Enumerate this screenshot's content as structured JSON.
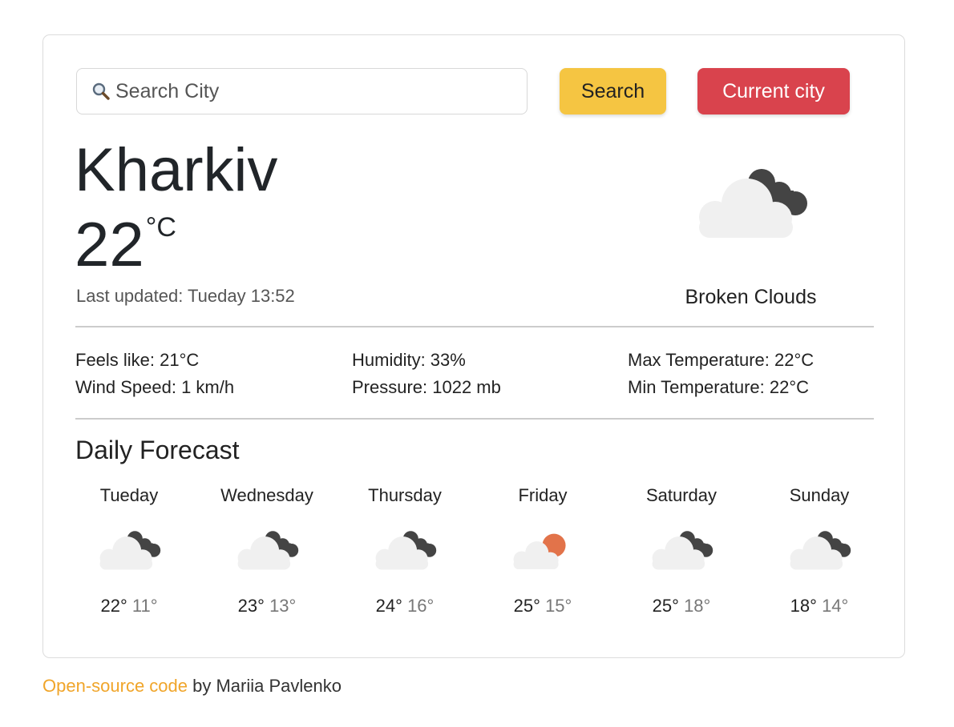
{
  "search": {
    "placeholder": "Search City",
    "button_label": "Search",
    "current_label": "Current city"
  },
  "weather": {
    "city": "Kharkiv",
    "temperature": "22",
    "unit": "°C",
    "last_updated": "Last updated: Tueday 13:52",
    "description": "Broken Clouds",
    "icon": "broken-clouds-icon"
  },
  "stats": {
    "feels_like": "Feels like: 21°C",
    "wind_speed": "Wind Speed: 1 km/h",
    "humidity": "Humidity: 33%",
    "pressure": "Pressure: 1022 mb",
    "max_temp": "Max Temperature: 22°C",
    "min_temp": "Min Temperature: 22°C"
  },
  "forecast": {
    "title": "Daily Forecast",
    "days": [
      {
        "day": "Tueday",
        "max": "22°",
        "min": "11°",
        "icon": "broken-clouds-icon"
      },
      {
        "day": "Wednesday",
        "max": "23°",
        "min": "13°",
        "icon": "broken-clouds-icon"
      },
      {
        "day": "Thursday",
        "max": "24°",
        "min": "16°",
        "icon": "broken-clouds-icon"
      },
      {
        "day": "Friday",
        "max": "25°",
        "min": "15°",
        "icon": "few-clouds-icon"
      },
      {
        "day": "Saturday",
        "max": "25°",
        "min": "18°",
        "icon": "broken-clouds-icon"
      },
      {
        "day": "Sunday",
        "max": "18°",
        "min": "14°",
        "icon": "broken-clouds-icon"
      }
    ]
  },
  "footer": {
    "link_text": "Open-source code",
    "rest": " by Mariia Pavlenko"
  },
  "colors": {
    "search": "#f5c542",
    "current": "#d9434d",
    "link": "#f0a52a"
  }
}
